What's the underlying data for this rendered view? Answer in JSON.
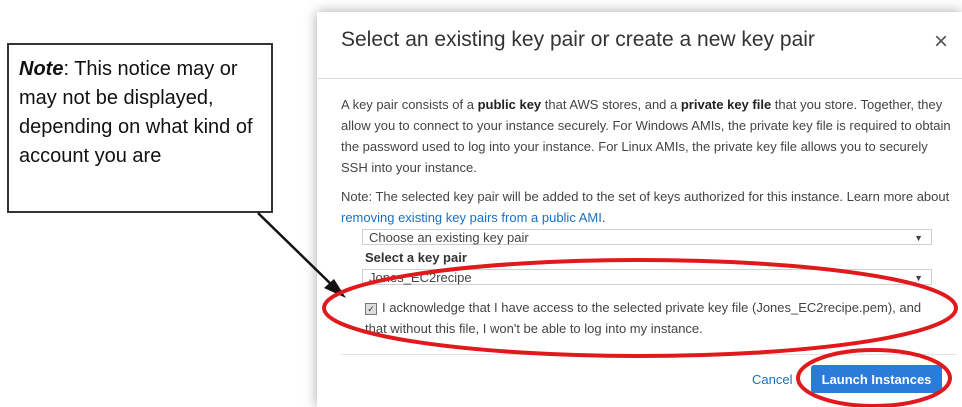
{
  "note_box": {
    "label": "Note",
    "text": ": This notice may or may not be displayed, depending on what kind of account you are"
  },
  "dialog": {
    "title": "Select an existing key pair or create a new key pair",
    "close_symbol": "×",
    "description": {
      "part1": "A key pair consists of a ",
      "bold1": "public key",
      "part2": " that AWS stores, and a ",
      "bold2": "private key file",
      "part3": " that you store. Together, they allow you to connect to your instance securely. For Windows AMIs, the private key file is required to obtain the password used to log into your instance. For Linux AMIs, the private key file allows you to securely SSH into your instance."
    },
    "note": {
      "text": "Note: The selected key pair will be added to the set of keys authorized for this instance. Learn more about ",
      "link": "removing existing key pairs from a public AMI",
      "after": "."
    },
    "key_pair_mode": {
      "selected": "Choose an existing key pair"
    },
    "select_key_pair": {
      "label": "Select a key pair",
      "selected": "Jones_EC2recipe"
    },
    "acknowledge": {
      "checked": true,
      "text": "I acknowledge that I have access to the selected private key file (Jones_EC2recipe.pem), and that without this file, I won't be able to log into my instance."
    },
    "footer": {
      "cancel_label": "Cancel",
      "launch_label": "Launch Instances"
    }
  },
  "annotation_color": "#e0191c",
  "arrow_color": "#111111"
}
